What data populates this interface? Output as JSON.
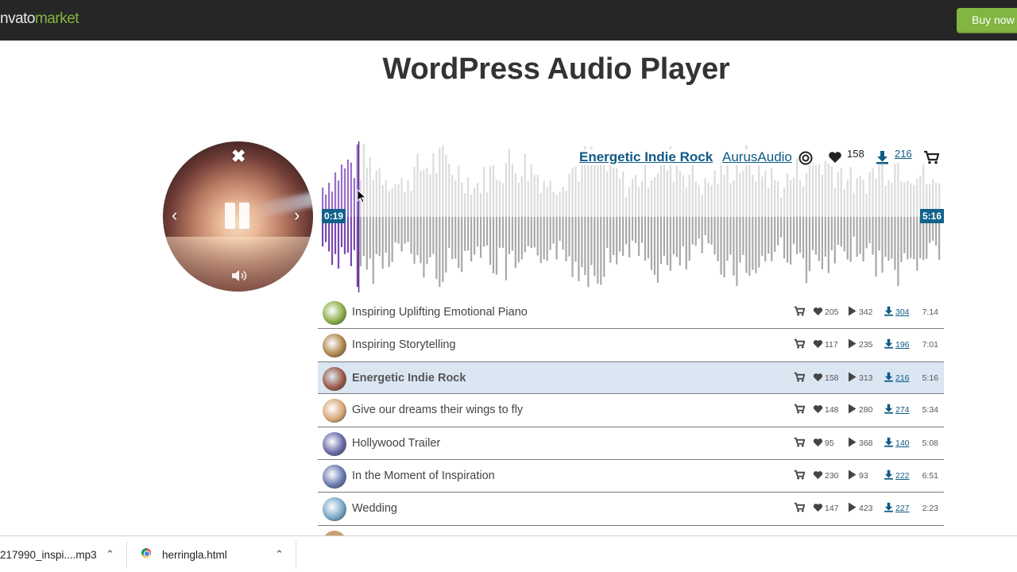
{
  "header": {
    "logo_part1": "nvato",
    "logo_part2": "market",
    "buy_label": "Buy now"
  },
  "page": {
    "title": "WordPress Audio Player"
  },
  "player": {
    "now_playing_title": "Energetic Indie Rock",
    "now_playing_artist": "AurusAudio",
    "likes": "158",
    "downloads": "216",
    "current_time": "0:19",
    "total_time": "5:16",
    "progress_fraction": 0.06,
    "icons": [
      "close-icon",
      "prev-icon",
      "pause-icon",
      "next-icon",
      "volume-icon",
      "target-icon",
      "heart-icon",
      "download-icon",
      "cart-icon"
    ]
  },
  "tracks": [
    {
      "title": "Inspiring Uplifting Emotional Piano",
      "likes": "205",
      "plays": "342",
      "downloads": "304",
      "duration": "7:14",
      "thumb": "#8bb04a"
    },
    {
      "title": "Inspiring Storytelling",
      "likes": "117",
      "plays": "235",
      "downloads": "196",
      "duration": "7:01",
      "thumb": "#b08850"
    },
    {
      "title": "Energetic Indie Rock",
      "likes": "158",
      "plays": "313",
      "downloads": "216",
      "duration": "5:16",
      "thumb": "#9a5a4a"
    },
    {
      "title": "Give our dreams their wings to fly",
      "likes": "148",
      "plays": "280",
      "downloads": "274",
      "duration": "5:34",
      "thumb": "#d8a878"
    },
    {
      "title": "Hollywood Trailer",
      "likes": "95",
      "plays": "368",
      "downloads": "140",
      "duration": "5:08",
      "thumb": "#6a6aa8"
    },
    {
      "title": "In the Moment of Inspiration",
      "likes": "230",
      "plays": "93",
      "downloads": "222",
      "duration": "6:51",
      "thumb": "#6a7ab0"
    },
    {
      "title": "Wedding",
      "likes": "147",
      "plays": "423",
      "downloads": "227",
      "duration": "2:23",
      "thumb": "#78a8c8"
    }
  ],
  "downloads_bar": {
    "item1": "217990_inspi....mp3",
    "item2": "herringla.html"
  },
  "colors": {
    "accent": "#0f5a85",
    "played_wave": "#8e5bbf",
    "wave": "#b5b5b5",
    "buy": "#82b541"
  }
}
